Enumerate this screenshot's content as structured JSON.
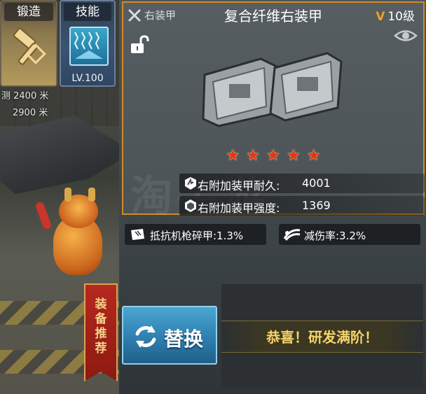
{
  "tabs": {
    "forge": {
      "label": "锻造"
    },
    "skill": {
      "label": "技能",
      "level": "LV.100"
    }
  },
  "scene": {
    "distance_1": "测 2400 米",
    "distance_2": "2900 米"
  },
  "recommend": {
    "chars": [
      "装",
      "备",
      "推",
      "荐"
    ]
  },
  "item": {
    "slot": "右装甲",
    "name": "复合纤维右装甲",
    "level_prefix": "V",
    "level": "10级",
    "stars": [
      "★",
      "★",
      "★",
      "★",
      "★"
    ],
    "star_count": 5,
    "stats": [
      {
        "label": "右附加装甲耐久:",
        "value": "4001",
        "icon": "durability-icon"
      },
      {
        "label": "右附加装甲强度:",
        "value": "1369",
        "icon": "strength-icon"
      }
    ],
    "sub_stats": [
      {
        "text": "抵抗机枪碎甲:1.3%",
        "icon": "armor-resist-icon"
      },
      {
        "text": "减伤率:3.2%",
        "icon": "damage-reduction-icon"
      }
    ]
  },
  "watermark": "淘手游",
  "actions": {
    "replace_label": "替换"
  },
  "congrats": {
    "text": "恭喜！研发满阶！"
  },
  "colors": {
    "card_border": "#d48a26",
    "star": "#e7321d",
    "level_v": "#f0a020",
    "replace_button": "#2f7fb0",
    "congrats_text": "#f6d36a"
  }
}
